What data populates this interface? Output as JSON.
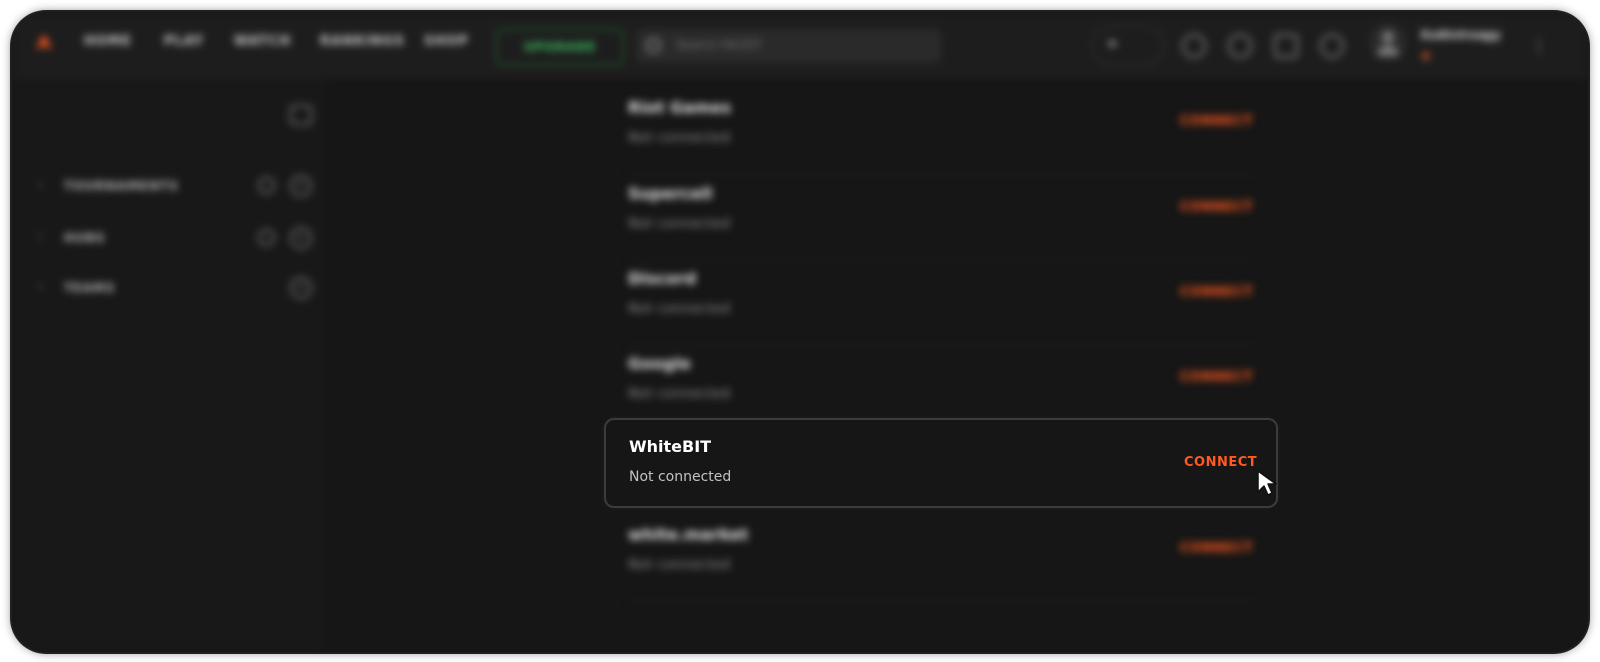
{
  "nav": {
    "items": [
      "HOME",
      "PLAY",
      "WATCH",
      "RANKINGS",
      "SHOP"
    ],
    "upgrade_label": "UPGRADE",
    "search_placeholder": "Search FACEIT"
  },
  "user": {
    "name": "XxAlvIrxagy",
    "coins": "0"
  },
  "sidebar": {
    "items": [
      {
        "label": "TOURNAMENTS"
      },
      {
        "label": "HUBS"
      },
      {
        "label": "TEAMS"
      }
    ]
  },
  "connections": [
    {
      "name": "Riot Games",
      "status": "Not connected",
      "action": "CONNECT"
    },
    {
      "name": "Supercell",
      "status": "Not connected",
      "action": "CONNECT"
    },
    {
      "name": "Discord",
      "status": "Not connected",
      "action": "CONNECT"
    },
    {
      "name": "Google",
      "status": "Not connected",
      "action": "CONNECT"
    },
    {
      "name": "WhiteBIT",
      "status": "Not connected",
      "action": "CONNECT"
    },
    {
      "name": "white.market",
      "status": "Not connected",
      "action": "CONNECT"
    }
  ],
  "colors": {
    "accent": "#ff5a1f",
    "upgrade": "#3ecb63",
    "background": "#161616"
  }
}
